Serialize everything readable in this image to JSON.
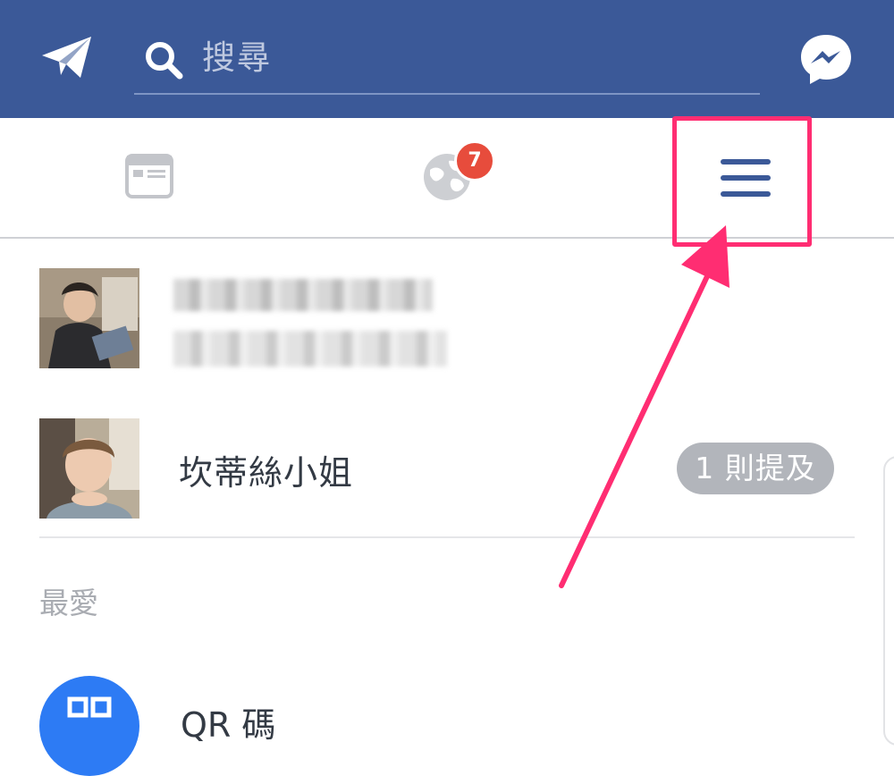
{
  "header": {
    "search_placeholder": "搜尋",
    "icons": {
      "left": "paper-plane-icon",
      "search": "search-icon",
      "right": "messenger-icon"
    }
  },
  "tabs": [
    {
      "name": "news-feed",
      "icon": "news-feed-icon"
    },
    {
      "name": "notifications",
      "icon": "globe-icon",
      "badge": "7"
    },
    {
      "name": "menu",
      "icon": "hamburger-icon",
      "highlighted": true
    }
  ],
  "profile": {
    "avatar": "avatar-photo"
  },
  "contacts": [
    {
      "name": "坎蒂絲小姐",
      "mention": "1 則提及"
    }
  ],
  "favorites": {
    "label": "最愛",
    "items": [
      {
        "name": "QR 碼"
      }
    ]
  },
  "colors": {
    "brand": "#3b5998",
    "highlight": "#ff2d72",
    "badge": "#e74c3c",
    "pill": "#b2b5bb"
  }
}
